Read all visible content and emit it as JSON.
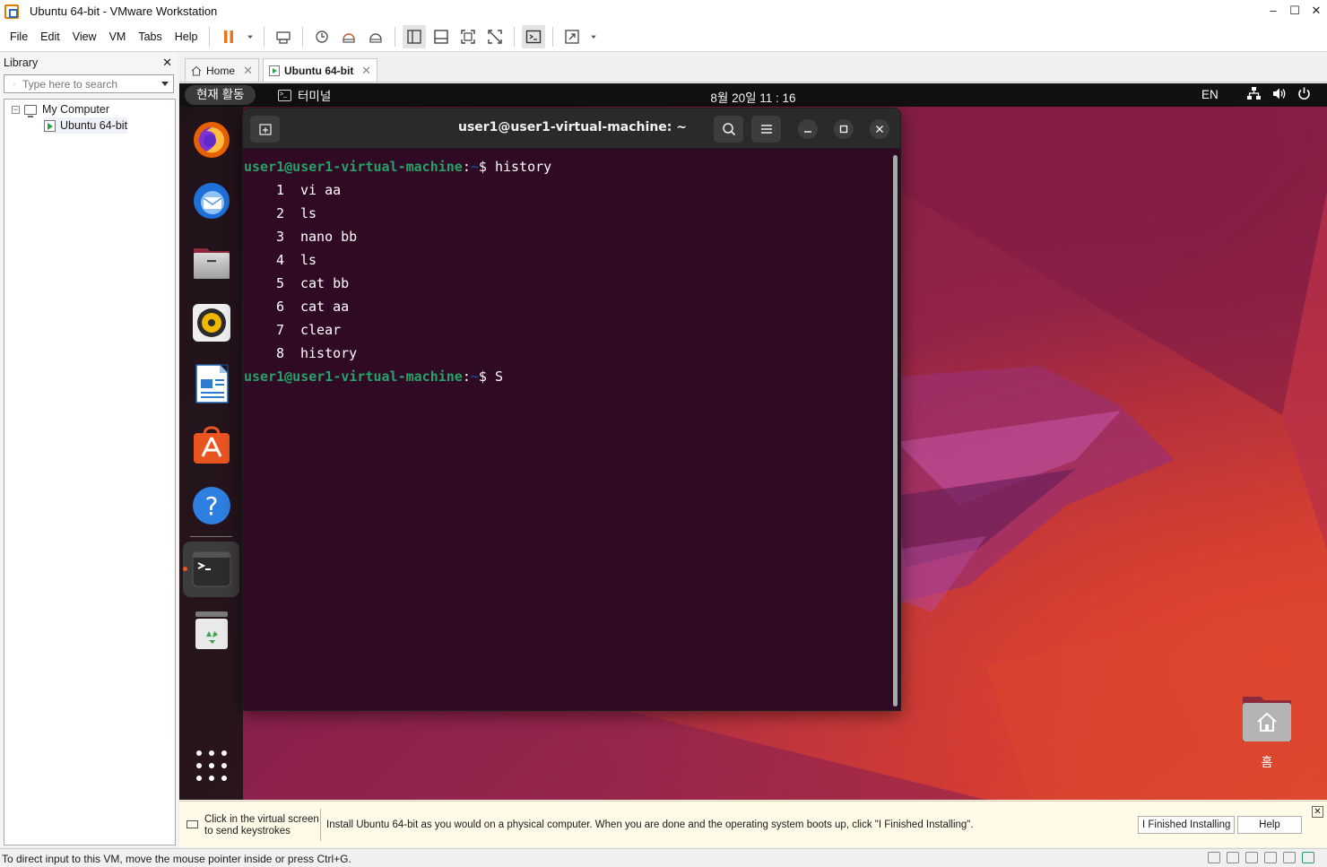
{
  "window": {
    "title": "Ubuntu 64-bit - VMware Workstation"
  },
  "menu": {
    "items": [
      "File",
      "Edit",
      "View",
      "VM",
      "Tabs",
      "Help"
    ]
  },
  "library": {
    "title": "Library",
    "search_placeholder": "Type here to search",
    "tree": {
      "root": "My Computer",
      "child": "Ubuntu 64-bit"
    }
  },
  "tabs": [
    {
      "label": "Home",
      "active": false
    },
    {
      "label": "Ubuntu 64-bit",
      "active": true
    }
  ],
  "gnome": {
    "activities": "현재 활동",
    "app_name": "터미널",
    "clock": "8월 20일  11 : 16",
    "lang": "EN"
  },
  "dock": {
    "apps": [
      "firefox-icon",
      "thunderbird-icon",
      "files-icon",
      "rhythmbox-icon",
      "writer-icon",
      "app-center-icon",
      "help-icon",
      "terminal-icon",
      "trash-icon"
    ]
  },
  "desktop": {
    "home_label": "홈"
  },
  "terminal": {
    "title": "user1@user1-virtual-machine: ~",
    "prompt_user": "user1@user1-virtual-machine",
    "prompt_path": "~",
    "prompt_symbol": "$ ",
    "command": "history",
    "history": [
      {
        "num": "1",
        "cmd": "vi aa"
      },
      {
        "num": "2",
        "cmd": "ls"
      },
      {
        "num": "3",
        "cmd": "nano bb"
      },
      {
        "num": "4",
        "cmd": "ls"
      },
      {
        "num": "5",
        "cmd": "cat bb"
      },
      {
        "num": "6",
        "cmd": "cat aa"
      },
      {
        "num": "7",
        "cmd": "clear"
      },
      {
        "num": "8",
        "cmd": "history"
      }
    ],
    "current_input": "S"
  },
  "install_bar": {
    "click_hint": "Click in the virtual screen to send keystrokes",
    "message": "Install Ubuntu 64-bit as you would on a physical computer. When you are done and the operating system boots up, click \"I Finished Installing\".",
    "finished_button": "I Finished Installing",
    "help_button": "Help"
  },
  "status": {
    "text": "To direct input to this VM, move the mouse pointer inside or press Ctrl+G."
  },
  "colors": {
    "prompt_green": "#26a269",
    "prompt_blue": "#12488b",
    "terminal_bg": "#300a24",
    "ubuntu_orange": "#e95420"
  }
}
